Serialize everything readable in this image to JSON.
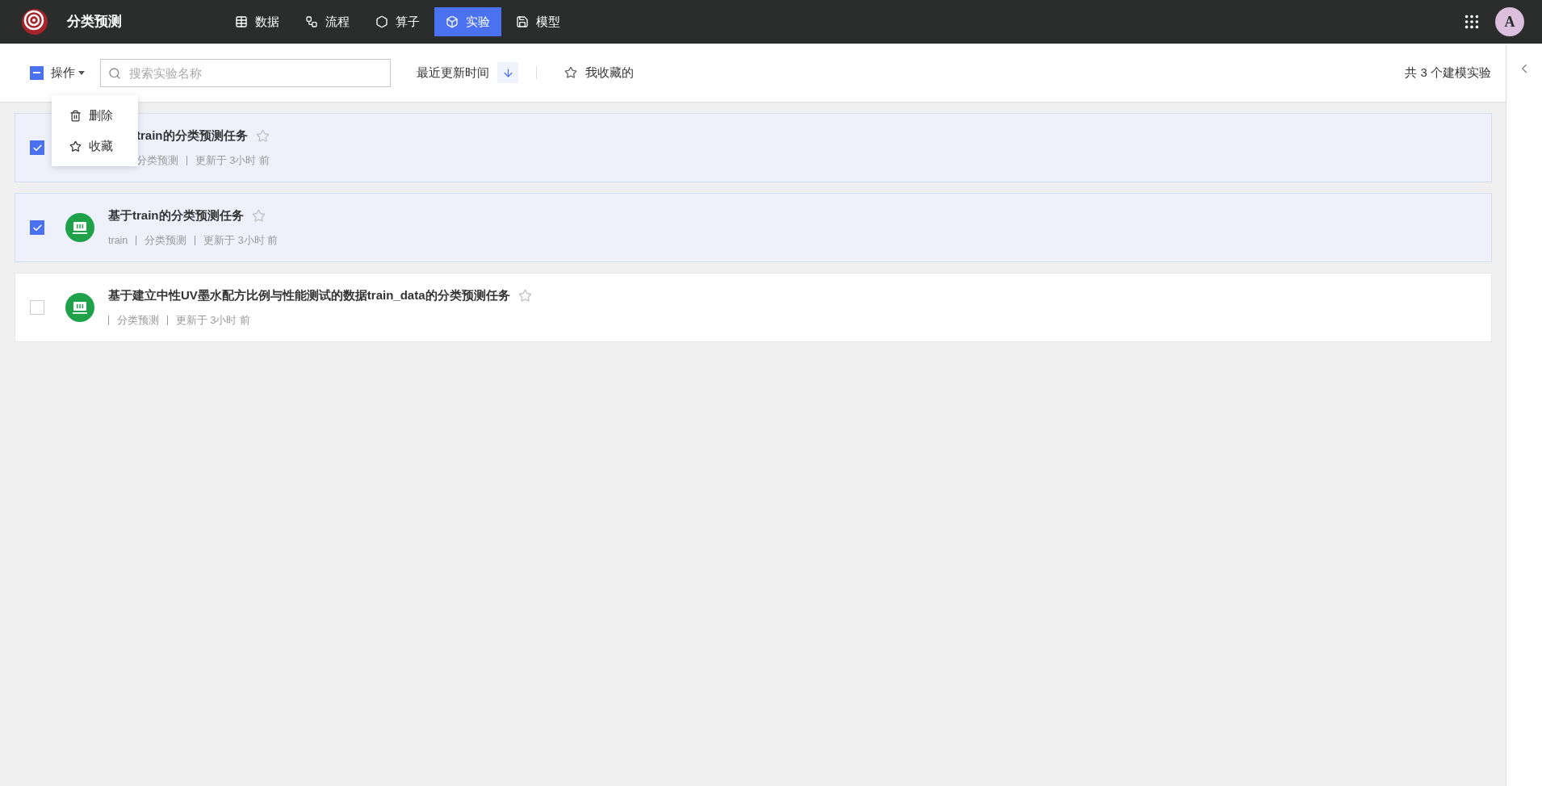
{
  "app": {
    "title": "分类预测"
  },
  "nav": [
    {
      "label": "数据",
      "kind": "table",
      "selected": false
    },
    {
      "label": "流程",
      "kind": "flow",
      "selected": false
    },
    {
      "label": "算子",
      "kind": "hex",
      "selected": false
    },
    {
      "label": "实验",
      "kind": "cube",
      "selected": true
    },
    {
      "label": "模型",
      "kind": "save",
      "selected": false
    }
  ],
  "user": {
    "initial": "A"
  },
  "toolbar": {
    "select_all": {
      "label": "操作",
      "indeterminate": true
    },
    "search": {
      "placeholder": "搜索实验名称"
    },
    "sort": {
      "label": "最近更新时间"
    },
    "favorites": {
      "label": "我收藏的"
    },
    "count": "共 3 个建模实验"
  },
  "menu": {
    "items": [
      {
        "label": "删除",
        "kind": "trash"
      },
      {
        "label": "收藏",
        "kind": "star"
      }
    ]
  },
  "experiments": [
    {
      "title": "train的分类预测任务",
      "clipped": true,
      "category": "分类预测",
      "updated": "更新于 3小时 前",
      "checked": true
    },
    {
      "title": "基于train的分类预测任务",
      "clipped": false,
      "source": "train",
      "category": "分类预测",
      "updated": "更新于 3小时 前",
      "checked": true
    },
    {
      "title": "基于建立中性UV墨水配方比例与性能测试的数据train_data的分类预测任务",
      "clipped": false,
      "category": "分类预测",
      "updated": "更新于 3小时 前",
      "checked": false
    }
  ]
}
